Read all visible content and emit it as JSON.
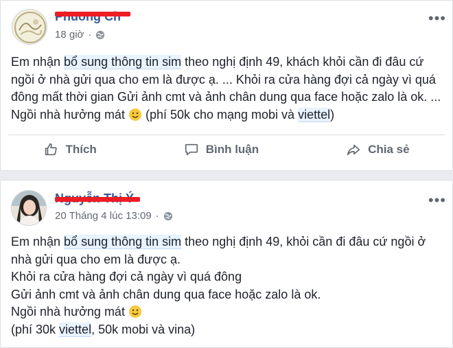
{
  "post1": {
    "author": "Phuong Ch",
    "time": "18 giờ",
    "text_before_link": "Em nhận ",
    "link1": "bổ sung thông tin sim",
    "text_mid": " theo nghị định 49, khách khỏi cần đi đâu cứ ngồi ở nhà gửi qua cho em là được ạ. ... Khỏi ra cửa hàng đợi cả ngày vì quá đông mất thời gian Gửi ảnh cmt và ảnh chân dung qua face hoặc zalo là ok. ... Ngồi nhà hưởng mát ",
    "text_after_emoji": " (phí 50k cho mạng mobi và ",
    "link2": "viettel",
    "text_end": ")",
    "actions": {
      "like": "Thích",
      "comment": "Bình luận",
      "share": "Chia sẻ"
    }
  },
  "post2": {
    "author": "Nguyễn Thị Ý",
    "time": "20 Tháng 4 lúc 13:09",
    "line1_before": "Em nhận ",
    "link1": "bổ sung thông tin sim",
    "line1_after": " theo nghị định 49, khỏi cần đi đâu cứ ngồi ở nhà gửi qua cho em là được ạ.",
    "line2": "Khỏi ra cửa hàng đợi cả ngày vì quá đông",
    "line3": "Gửi ảnh cmt và ảnh chân dung qua face hoặc zalo là ok.",
    "line4": "Ngồi nhà hưởng mát ",
    "line5_before": "(phí 30k ",
    "link2": "viettel",
    "line5_after": ", 50k mobi và vina)"
  },
  "icons": {
    "globe": "globe-icon",
    "more": "more-options-icon",
    "emoji": "smiley-emoji-icon",
    "like": "thumbs-up-icon",
    "comment": "speech-bubble-icon",
    "share": "share-arrow-icon"
  },
  "colors": {
    "author_link": "#385898",
    "redaction": "#ee1c25",
    "meta_text": "#616770",
    "hashtag_bg": "#e7f3ff"
  }
}
